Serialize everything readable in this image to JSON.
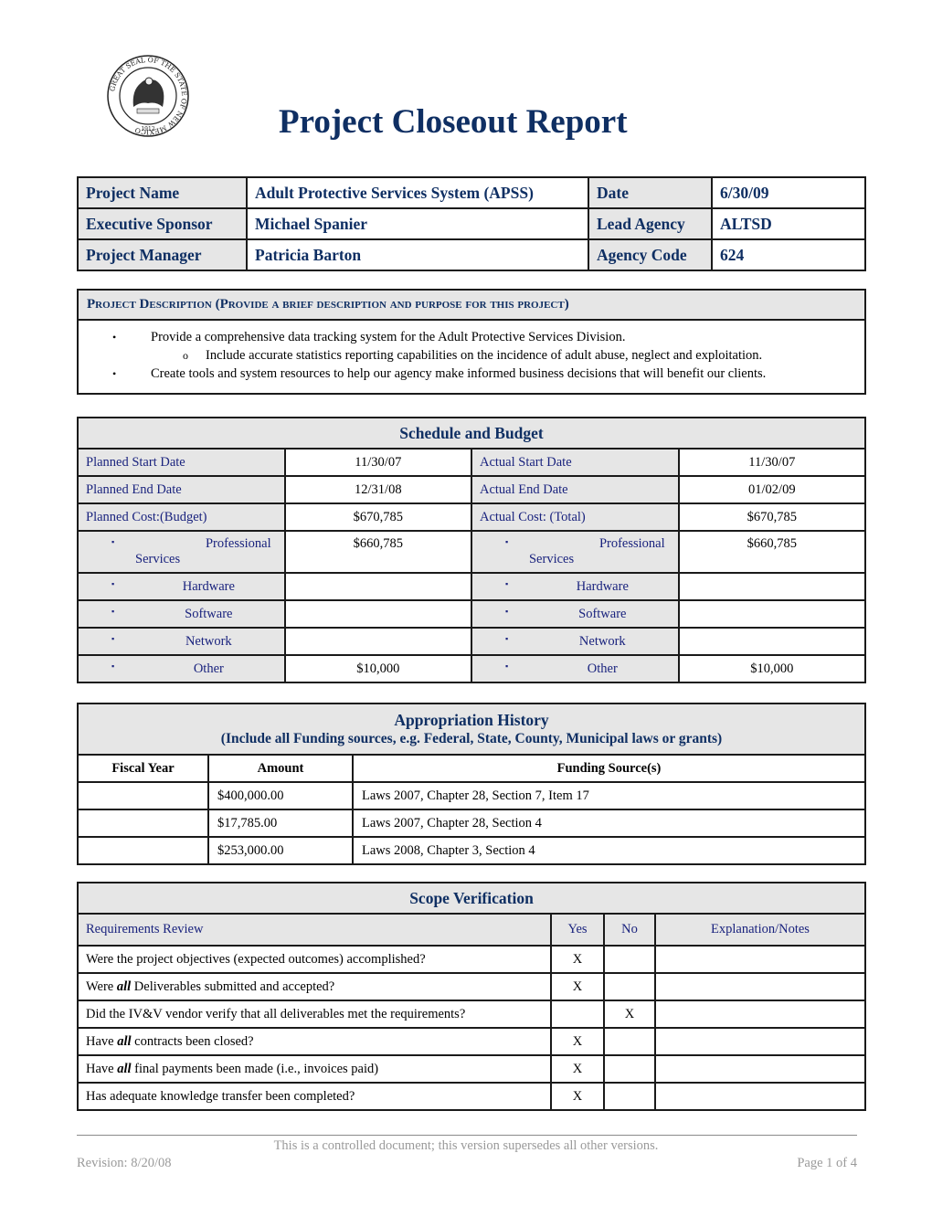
{
  "header": {
    "seal_alt": "Great Seal of the State of New Mexico",
    "seal_ring_text": "GREAT SEAL OF THE STATE OF NEW MEXICO",
    "seal_year": "1912",
    "title": "Project Closeout Report"
  },
  "info": {
    "rows": [
      {
        "label1": "Project Name",
        "value1": "Adult Protective Services System (APSS)",
        "label2": "Date",
        "value2": "6/30/09"
      },
      {
        "label1": "Executive Sponsor",
        "value1": "Michael Spanier",
        "label2": "Lead Agency",
        "value2": "ALTSD"
      },
      {
        "label1": "Project Manager",
        "value1": "Patricia Barton",
        "label2": "Agency Code",
        "value2": "624"
      }
    ]
  },
  "description": {
    "heading": "Project Description (Provide a brief description and purpose for this project)",
    "items": [
      {
        "level": 1,
        "text": "Provide a comprehensive data tracking system for the Adult Protective Services Division."
      },
      {
        "level": 2,
        "text": "Include accurate statistics reporting capabilities on the incidence of adult abuse, neglect and exploitation."
      },
      {
        "level": 1,
        "text": "Create tools and system resources to help our agency make informed business decisions that will benefit our clients."
      }
    ],
    "bullet_l1": "•",
    "bullet_l2": "o"
  },
  "schedule": {
    "title": "Schedule and Budget",
    "rows": [
      {
        "label1": "Planned Start Date",
        "value1": "11/30/07",
        "label2": "Actual Start Date",
        "value2": "11/30/07"
      },
      {
        "label1": "Planned End Date",
        "value1": "12/31/08",
        "label2": "Actual End Date",
        "value2": "01/02/09"
      },
      {
        "label1": "Planned Cost:(Budget)",
        "value1": "$670,785",
        "label2": "Actual Cost: (Total)",
        "value2": "$670,785"
      }
    ],
    "sub_bullet": "▪",
    "professional": {
      "label_a": "Professional",
      "label_b": "Services",
      "planned": "$660,785",
      "actual": "$660,785"
    },
    "sub_rows": [
      {
        "label": "Hardware",
        "planned": "",
        "actual": ""
      },
      {
        "label": "Software",
        "planned": "",
        "actual": ""
      },
      {
        "label": "Network",
        "planned": "",
        "actual": ""
      },
      {
        "label": "Other",
        "planned": "$10,000",
        "actual": "$10,000"
      }
    ]
  },
  "appropriation": {
    "title": "Appropriation History",
    "subtitle": "(Include all Funding sources, e.g. Federal, State, County, Municipal laws or grants)",
    "columns": [
      "Fiscal Year",
      "Amount",
      "Funding Source(s)"
    ],
    "rows": [
      {
        "fiscal_year": "",
        "amount": "$400,000.00",
        "source": "Laws 2007, Chapter 28, Section 7, Item 17"
      },
      {
        "fiscal_year": "",
        "amount": "$17,785.00",
        "source": "Laws 2007, Chapter 28, Section 4"
      },
      {
        "fiscal_year": "",
        "amount": "$253,000.00",
        "source": "Laws 2008, Chapter 3, Section 4"
      }
    ]
  },
  "scope": {
    "title": "Scope Verification",
    "columns": [
      "Requirements Review",
      "Yes",
      "No",
      "Explanation/Notes"
    ],
    "rows": [
      {
        "pre": "Were the project objectives (expected outcomes) accomplished?",
        "em": "",
        "post": "",
        "yes": "X",
        "no": "",
        "notes": ""
      },
      {
        "pre": "Were ",
        "em": "all",
        "post": " Deliverables submitted and accepted?",
        "yes": "X",
        "no": "",
        "notes": ""
      },
      {
        "pre": "Did the IV&V vendor verify that all deliverables met the requirements?",
        "em": "",
        "post": "",
        "yes": "",
        "no": "X",
        "notes": ""
      },
      {
        "pre": "Have ",
        "em": "all",
        "post": " contracts been closed?",
        "yes": "X",
        "no": "",
        "notes": ""
      },
      {
        "pre": "Have ",
        "em": "all",
        "post": " final payments been made (i.e., invoices paid)",
        "yes": "X",
        "no": "",
        "notes": ""
      },
      {
        "pre": "Has adequate knowledge transfer been completed?",
        "em": "",
        "post": "",
        "yes": "X",
        "no": "",
        "notes": ""
      }
    ]
  },
  "footer": {
    "note": "This is a controlled document; this version supersedes all other versions.",
    "revision": "Revision: 8/20/08",
    "page": "Page 1 of 4"
  }
}
